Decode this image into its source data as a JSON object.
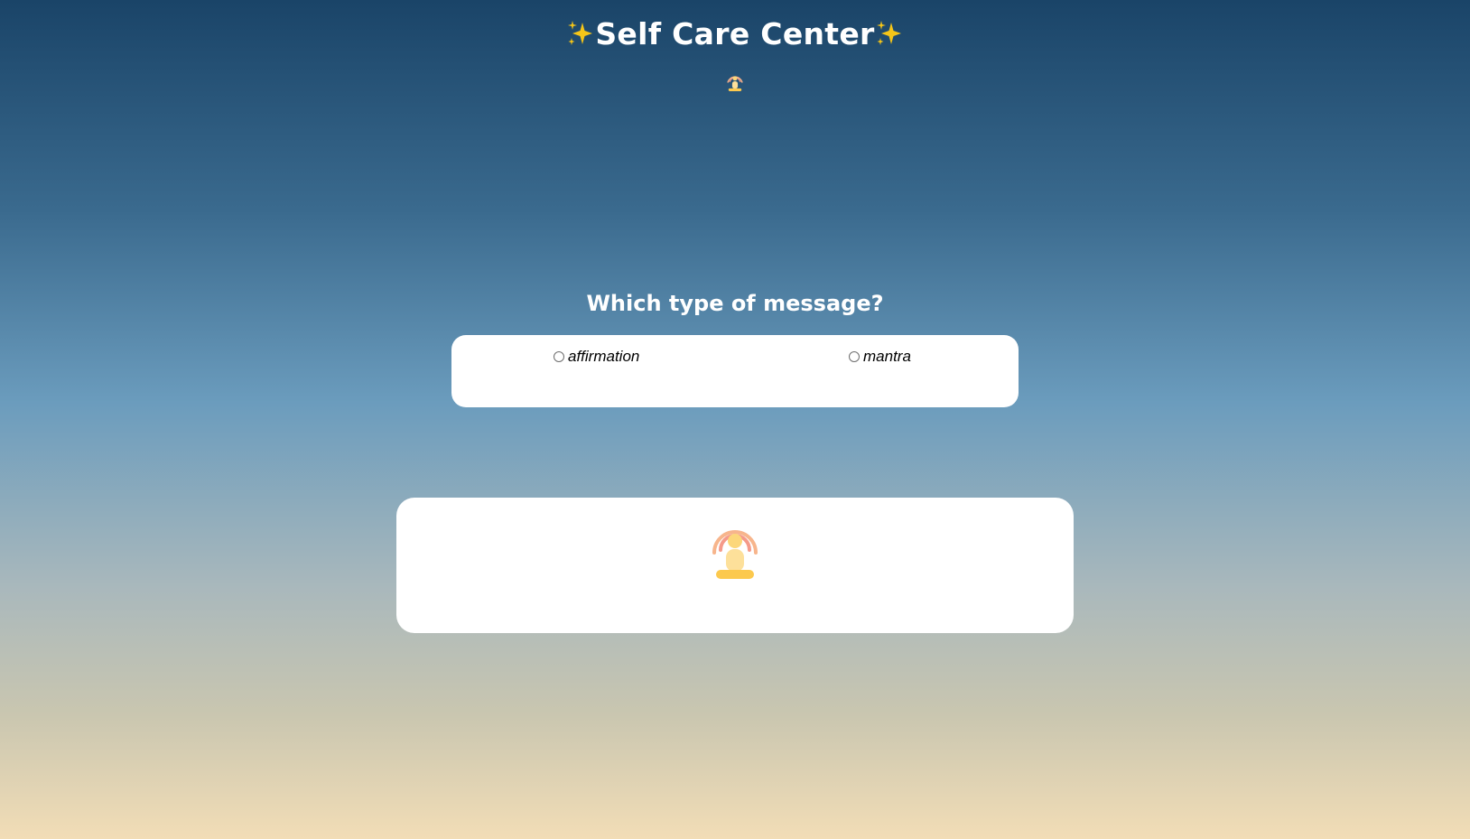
{
  "header": {
    "title": "Self Care Center",
    "sparkle_icon": "sparkles-icon",
    "meditation_icon": "meditating-person-icon"
  },
  "question": {
    "text": "Which type of message?"
  },
  "options": [
    {
      "label": "affirmation",
      "selected": false
    },
    {
      "label": "mantra",
      "selected": false
    }
  ],
  "result": {
    "icon": "meditating-person-icon"
  },
  "colors": {
    "gradient_top": "#1a4468",
    "gradient_bottom": "#f2ddb6",
    "card": "#ffffff",
    "sparkle": "#f5c518",
    "icon_body": "#fcd77a",
    "icon_rings": "#f59a8a"
  }
}
